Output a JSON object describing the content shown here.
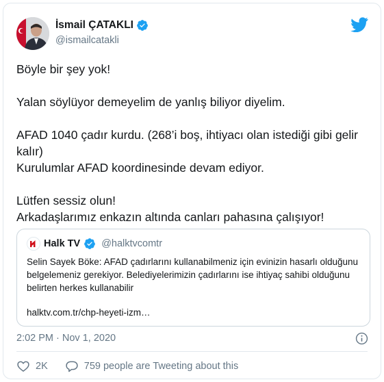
{
  "author": {
    "display_name": "İsmail ÇATAKLI",
    "handle": "@ismailcatakli"
  },
  "tweet": {
    "text": "Böyle bir şey yok!\n\nYalan söylüyor demeyelim de yanlış biliyor diyelim.\n\nAFAD 1040 çadır kurdu. (268’i boş, ihtiyacı olan istediği gibi gelir kalır)\nKurulumlar AFAD koordinesinde devam ediyor.\n\nLütfen sessiz olun!\nArkadaşlarımız enkazın altında canları pahasına çalışıyor!"
  },
  "quoted_tweet": {
    "display_name": "Halk TV",
    "handle": "@halktvcomtr",
    "text": "Selin Sayek Böke: AFAD çadırlarını kullanabilmeniz için evinizin hasarlı olduğunu belgelemeniz gerekiyor. Belediyelerimizin çadırlarını ise ihtiyaç sahibi olduğunu belirten herkes kullanabilir",
    "link": "halktv.com.tr/chp-heyeti-izm…"
  },
  "meta": {
    "timestamp": "2:02 PM · Nov 1, 2020"
  },
  "actions": {
    "likes": "2K",
    "conversation": "759 people are Tweeting about this"
  },
  "colors": {
    "twitter_blue": "#1da1f2",
    "secondary_text": "#657786",
    "border": "#e1e8ed"
  },
  "icons": [
    "twitter-logo-icon",
    "verified-icon",
    "info-icon",
    "heart-icon",
    "reply-icon"
  ]
}
